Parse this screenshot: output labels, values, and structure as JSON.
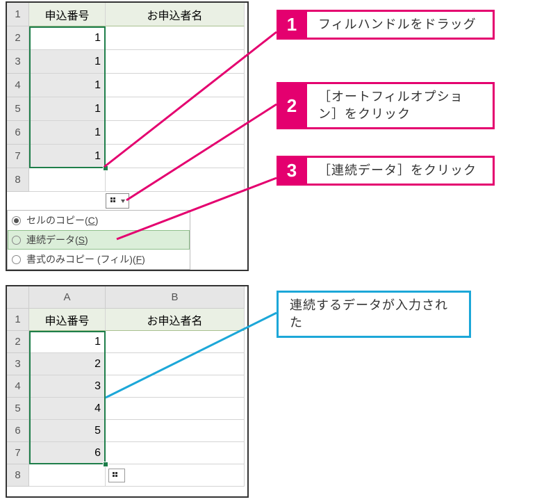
{
  "panel1": {
    "rows": [
      "1",
      "2",
      "3",
      "4",
      "5",
      "6",
      "7",
      "8"
    ],
    "headerA": "申込番号",
    "headerB": "お申込者名",
    "values": [
      "1",
      "1",
      "1",
      "1",
      "1",
      "1"
    ],
    "menu": {
      "copy": "セルのコピー(",
      "copy_key": "C",
      "copy_suffix": ")",
      "series": "連続データ(",
      "series_key": "S",
      "series_suffix": ")",
      "format": "書式のみコピー (フィル)(",
      "format_key": "F",
      "format_suffix": ")"
    }
  },
  "panel2": {
    "cols": [
      "A",
      "B"
    ],
    "rows": [
      "1",
      "2",
      "3",
      "4",
      "5",
      "6",
      "7",
      "8"
    ],
    "headerA": "申込番号",
    "headerB": "お申込者名",
    "values": [
      "1",
      "2",
      "3",
      "4",
      "5",
      "6"
    ]
  },
  "callouts": {
    "c1_num": "1",
    "c1_txt": "フィルハンドルをドラッグ",
    "c2_num": "2",
    "c2_txt": "［オートフィルオプション］をクリック",
    "c3_num": "3",
    "c3_txt": "［連続データ］をクリック",
    "c4_txt": "連続するデータが入力された"
  },
  "colors": {
    "pink": "#e4006f",
    "blue": "#1ca7d8",
    "green": "#1e7e4a"
  }
}
